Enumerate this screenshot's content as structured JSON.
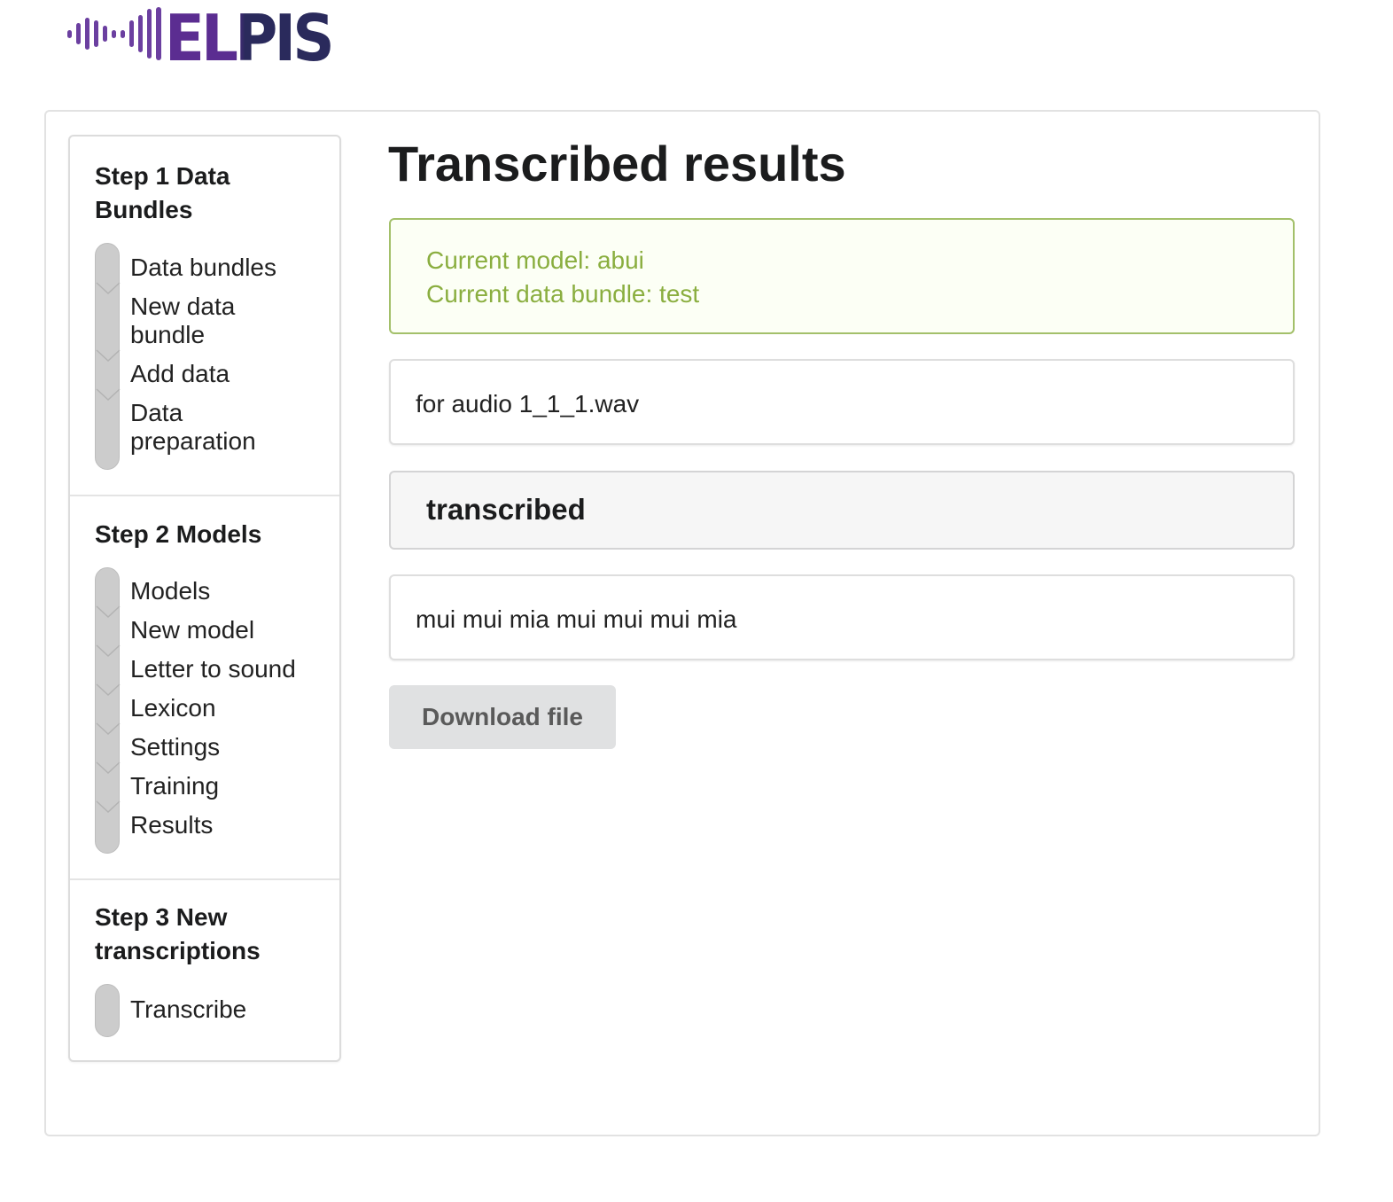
{
  "header": {
    "logo_text": "ELPIS",
    "brand_colors": {
      "wave": "#6b3fa0",
      "letters_purple": "#5b2d91",
      "letters_navy": "#2a2a5c"
    }
  },
  "sidebar": {
    "steps": [
      {
        "title": "Step 1 Data Bundles",
        "title_lines": [
          "Step 1 Data",
          "Bundles"
        ],
        "items": [
          {
            "label_lines": [
              "Data bundles"
            ]
          },
          {
            "label_lines": [
              "New data",
              "bundle"
            ]
          },
          {
            "label_lines": [
              "Add data"
            ]
          },
          {
            "label_lines": [
              "Data",
              "preparation"
            ]
          }
        ]
      },
      {
        "title": "Step 2 Models",
        "title_lines": [
          "Step 2 Models"
        ],
        "items": [
          {
            "label_lines": [
              "Models"
            ]
          },
          {
            "label_lines": [
              "New model"
            ]
          },
          {
            "label_lines": [
              "Letter to sound"
            ]
          },
          {
            "label_lines": [
              "Lexicon"
            ]
          },
          {
            "label_lines": [
              "Settings"
            ]
          },
          {
            "label_lines": [
              "Training"
            ]
          },
          {
            "label_lines": [
              "Results"
            ]
          }
        ]
      },
      {
        "title": "Step 3 New transcriptions",
        "title_lines": [
          "Step 3 New",
          "transcriptions"
        ],
        "items": [
          {
            "label_lines": [
              "Transcribe"
            ]
          }
        ]
      }
    ]
  },
  "main": {
    "title": "Transcribed results",
    "status": {
      "model_line": "Current model: abui",
      "bundle_line": "Current data bundle: test",
      "accent_color": "#8aae3f"
    },
    "audio_label": "for audio 1_1_1.wav",
    "section_header": "transcribed",
    "transcription_text": "mui mui mia mui mui mui mia",
    "download_button_label": "Download file"
  }
}
